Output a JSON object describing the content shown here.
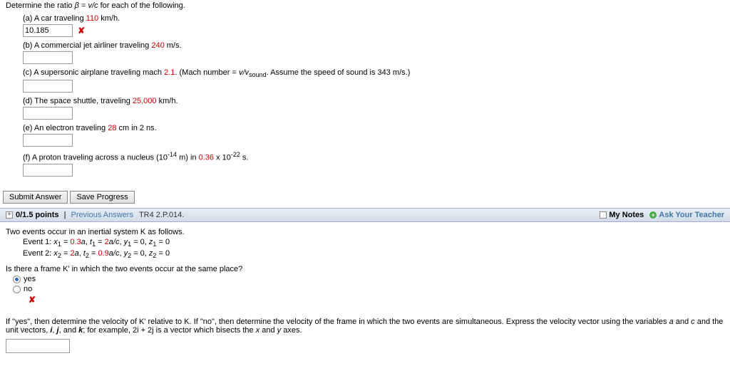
{
  "q1": {
    "prompt_pre": "Determine the ratio ",
    "prompt_beta": "β",
    "prompt_mid": " = ",
    "prompt_vc": "v/c",
    "prompt_post": " for each of the following.",
    "a": {
      "label_pre": "(a) A car traveling ",
      "val": "110",
      "label_post": " km/h.",
      "entered": "10.185"
    },
    "b": {
      "label_pre": "(b) A commercial jet airliner traveling ",
      "val": "240",
      "label_post": " m/s."
    },
    "c": {
      "label_pre": "(c) A supersonic airplane traveling mach ",
      "val": "2.1",
      "label_mid": ". (Mach number = ",
      "vv": "v/v",
      "sub": "sound",
      "label_post": ". Assume the speed of sound is 343 m/s.)"
    },
    "d": {
      "label_pre": "(d) The space shuttle, traveling ",
      "val": "25,000",
      "label_post": " km/h."
    },
    "e": {
      "label_pre": "(e) An electron traveling ",
      "val": "28",
      "label_post": " cm in 2 ns."
    },
    "f": {
      "label_pre": "(f) A proton traveling across a nucleus (10",
      "sup1": "-14",
      "label_mid": " m) in ",
      "val": "0.36",
      "label_mid2": " x 10",
      "sup2": "-22",
      "label_post": " s."
    }
  },
  "buttons": {
    "submit": "Submit Answer",
    "save": "Save Progress"
  },
  "bar": {
    "expand": "+",
    "points": "0/1.5 points",
    "prev": "Previous Answers",
    "code": "TR4 2.P.014.",
    "notes": "My Notes",
    "ask": "Ask Your Teacher",
    "plus": "+"
  },
  "q2": {
    "intro": "Two events occur in an inertial system K as follows.",
    "event1_pre": "Event 1: ",
    "e1_x_lbl": "x",
    "e1_x_sub": "1",
    "e1_x_eq": " = ",
    "e1_x_val": "0.3",
    "e1_a": "a",
    "e1_sep1": ", ",
    "e1_t_lbl": "t",
    "e1_t_sub": "1",
    "e1_t_eq": " = ",
    "e1_t_val": "2",
    "e1_ac": "a/c",
    "e1_sep2": ", ",
    "e1_y_lbl": "y",
    "e1_y_sub": "1",
    "e1_y_eq": " = 0, ",
    "e1_z_lbl": "z",
    "e1_z_sub": "1",
    "e1_z_eq": " = 0",
    "event2_pre": "Event 2: ",
    "e2_x_lbl": "x",
    "e2_x_sub": "2",
    "e2_x_eq": " = ",
    "e2_x_val": "2",
    "e2_a": "a",
    "e2_sep1": ", ",
    "e2_t_lbl": "t",
    "e2_t_sub": "2",
    "e2_t_eq": " = ",
    "e2_t_val": "0.9",
    "e2_ac": "a/c",
    "e2_sep2": ", ",
    "e2_y_lbl": "y",
    "e2_y_sub": "2",
    "e2_y_eq": " = 0, ",
    "e2_z_lbl": "z",
    "e2_z_sub": "2",
    "e2_z_eq": " = 0",
    "question": "Is there a frame K' in which the two events occur at the same place?",
    "yes": "yes",
    "no": "no",
    "followup_1": "If \"yes\", then determine the velocity of K' relative to K. If \"no\", then determine the velocity of the frame in which the two events are simultaneous. Express the velocity vector using the variables ",
    "var_a": "a",
    "and1": " and ",
    "var_c": "c",
    "followup_2": " and the unit vectors, ",
    "vec_i": "i",
    "comma1": ", ",
    "vec_j": "j",
    "comma2": ", and ",
    "vec_k": "k",
    "followup_3": "; for example, 2i + 2j is a vector which bisects the ",
    "axis_x": "x",
    "and2": " and ",
    "axis_y": "y",
    "followup_4": " axes."
  }
}
